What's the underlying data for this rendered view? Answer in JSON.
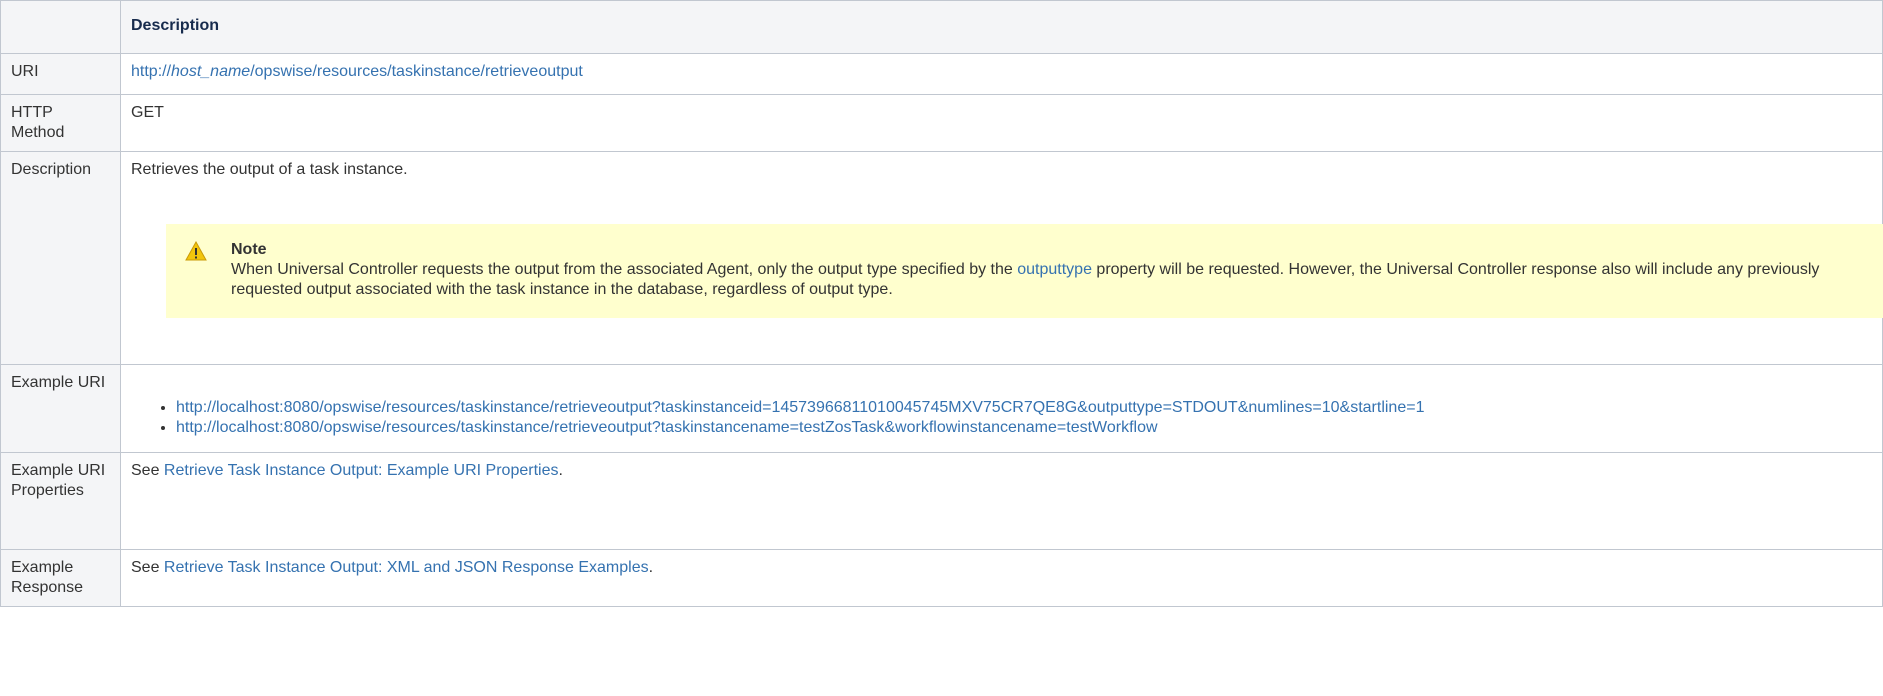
{
  "header": {
    "label_col": "",
    "description_col": "Description"
  },
  "uri_row": {
    "label": "URI",
    "prefix": "http://",
    "host": "host_name",
    "path": "/opswise/resources/taskinstance/retrieveoutput"
  },
  "method_row": {
    "label": "HTTP Method",
    "value": "GET"
  },
  "description_row": {
    "label": "Description",
    "text": "Retrieves the output of a task instance.",
    "note": {
      "title": "Note",
      "text_before_link": "When Universal Controller requests the output from the associated Agent, only the output type specified by the ",
      "link_text": "outputtype",
      "text_after_link": " property will be requested. However, the Universal Controller response also will include any previously requested output associated with the task instance in the database, regardless of output type."
    }
  },
  "example_uri_row": {
    "label": "Example URI",
    "items": [
      "http://localhost:8080/opswise/resources/taskinstance/retrieveoutput?taskinstanceid=1457396681101004574​5MXV75CR7QE8G&outputtype=STDOUT&numlines=10&startline=1",
      "http://localhost:8080/opswise/resources/taskinstance/retrieveoutput?taskinstancename=testZosTask&workflowinstancename=testWorkflow"
    ]
  },
  "example_props_row": {
    "label": "Example URI Properties",
    "prefix": "See ",
    "link_text": "Retrieve Task Instance Output: Example URI Properties",
    "suffix": "."
  },
  "example_response_row": {
    "label": "Example Response",
    "prefix": "See ",
    "link_text": "Retrieve Task Instance Output: XML and JSON Response Examples",
    "suffix": "."
  },
  "colors": {
    "link": "#3572b0",
    "header_bg": "#f4f5f7",
    "note_bg": "#ffffce",
    "warning_icon": "#f2c50c"
  }
}
